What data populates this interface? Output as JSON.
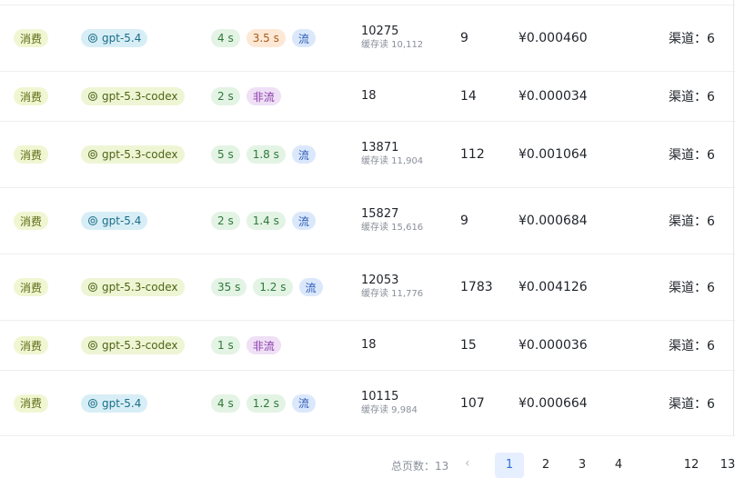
{
  "rows": [
    {
      "type": "消费",
      "model": "gpt-5.4",
      "model_color": "blue",
      "time": "4 s",
      "first": "3.5 s",
      "first_color": "orange",
      "stream": "流",
      "stream_kind": "stream",
      "tokens": "10275",
      "cache": "缓存读 10,112",
      "out": "9",
      "cost": "¥0.000460",
      "channel": "渠道：6"
    },
    {
      "type": "消费",
      "model": "gpt-5.3-codex",
      "model_color": "green",
      "time": "2 s",
      "first": "",
      "first_color": "",
      "stream": "非流",
      "stream_kind": "nostream",
      "tokens": "18",
      "cache": "",
      "out": "14",
      "cost": "¥0.000034",
      "channel": "渠道：6"
    },
    {
      "type": "消费",
      "model": "gpt-5.3-codex",
      "model_color": "green",
      "time": "5 s",
      "first": "1.8 s",
      "first_color": "green",
      "stream": "流",
      "stream_kind": "stream",
      "tokens": "13871",
      "cache": "缓存读 11,904",
      "out": "112",
      "cost": "¥0.001064",
      "channel": "渠道：6"
    },
    {
      "type": "消费",
      "model": "gpt-5.4",
      "model_color": "blue",
      "time": "2 s",
      "first": "1.4 s",
      "first_color": "green",
      "stream": "流",
      "stream_kind": "stream",
      "tokens": "15827",
      "cache": "缓存读 15,616",
      "out": "9",
      "cost": "¥0.000684",
      "channel": "渠道：6"
    },
    {
      "type": "消费",
      "model": "gpt-5.3-codex",
      "model_color": "green",
      "time": "35 s",
      "first": "1.2 s",
      "first_color": "green",
      "stream": "流",
      "stream_kind": "stream",
      "tokens": "12053",
      "cache": "缓存读 11,776",
      "out": "1783",
      "cost": "¥0.004126",
      "channel": "渠道：6"
    },
    {
      "type": "消费",
      "model": "gpt-5.3-codex",
      "model_color": "green",
      "time": "1 s",
      "first": "",
      "first_color": "",
      "stream": "非流",
      "stream_kind": "nostream",
      "tokens": "18",
      "cache": "",
      "out": "15",
      "cost": "¥0.000036",
      "channel": "渠道：6"
    },
    {
      "type": "消费",
      "model": "gpt-5.4",
      "model_color": "blue",
      "time": "4 s",
      "first": "1.2 s",
      "first_color": "green",
      "stream": "流",
      "stream_kind": "stream",
      "tokens": "10115",
      "cache": "缓存读 9,984",
      "out": "107",
      "cost": "¥0.000664",
      "channel": "渠道：6"
    }
  ],
  "pagination": {
    "label": "总页数：13",
    "prev_icon": "chevron-left-icon",
    "pages": [
      "1",
      "2",
      "3",
      "4",
      "...",
      "12",
      "13"
    ],
    "active": "1"
  },
  "model_icon": "openai-icon"
}
